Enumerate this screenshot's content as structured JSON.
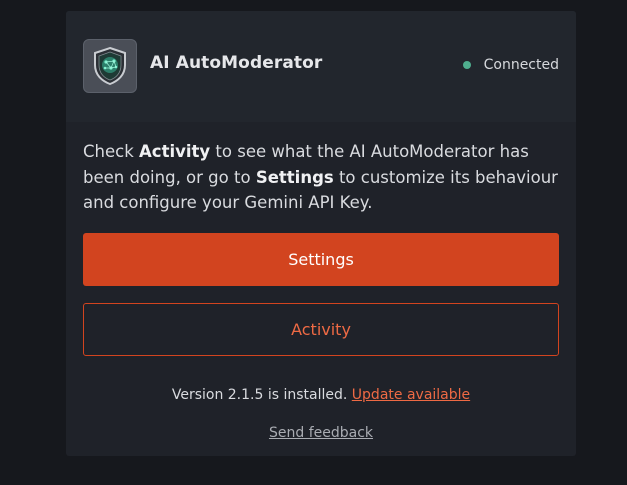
{
  "app": {
    "title": "AI AutoModerator",
    "logo_icon": "shield-brain-icon",
    "status_label": "Connected",
    "status_color": "#4fae8e"
  },
  "description": {
    "pre": "Check ",
    "activity_word": "Activity",
    "mid": " to see what the AI AutoModerator has been doing, or go to ",
    "settings_word": "Settings",
    "post": " to customize its behaviour and configure your Gemini API Key."
  },
  "buttons": {
    "settings_label": "Settings",
    "activity_label": "Activity"
  },
  "footer": {
    "version_text": "Version 2.1.5 is installed. ",
    "update_link": "Update available",
    "feedback_link": "Send feedback"
  },
  "colors": {
    "accent": "#d2441f",
    "accent_text": "#ee6a44",
    "background": "#16181d",
    "panel": "#1f2229"
  }
}
